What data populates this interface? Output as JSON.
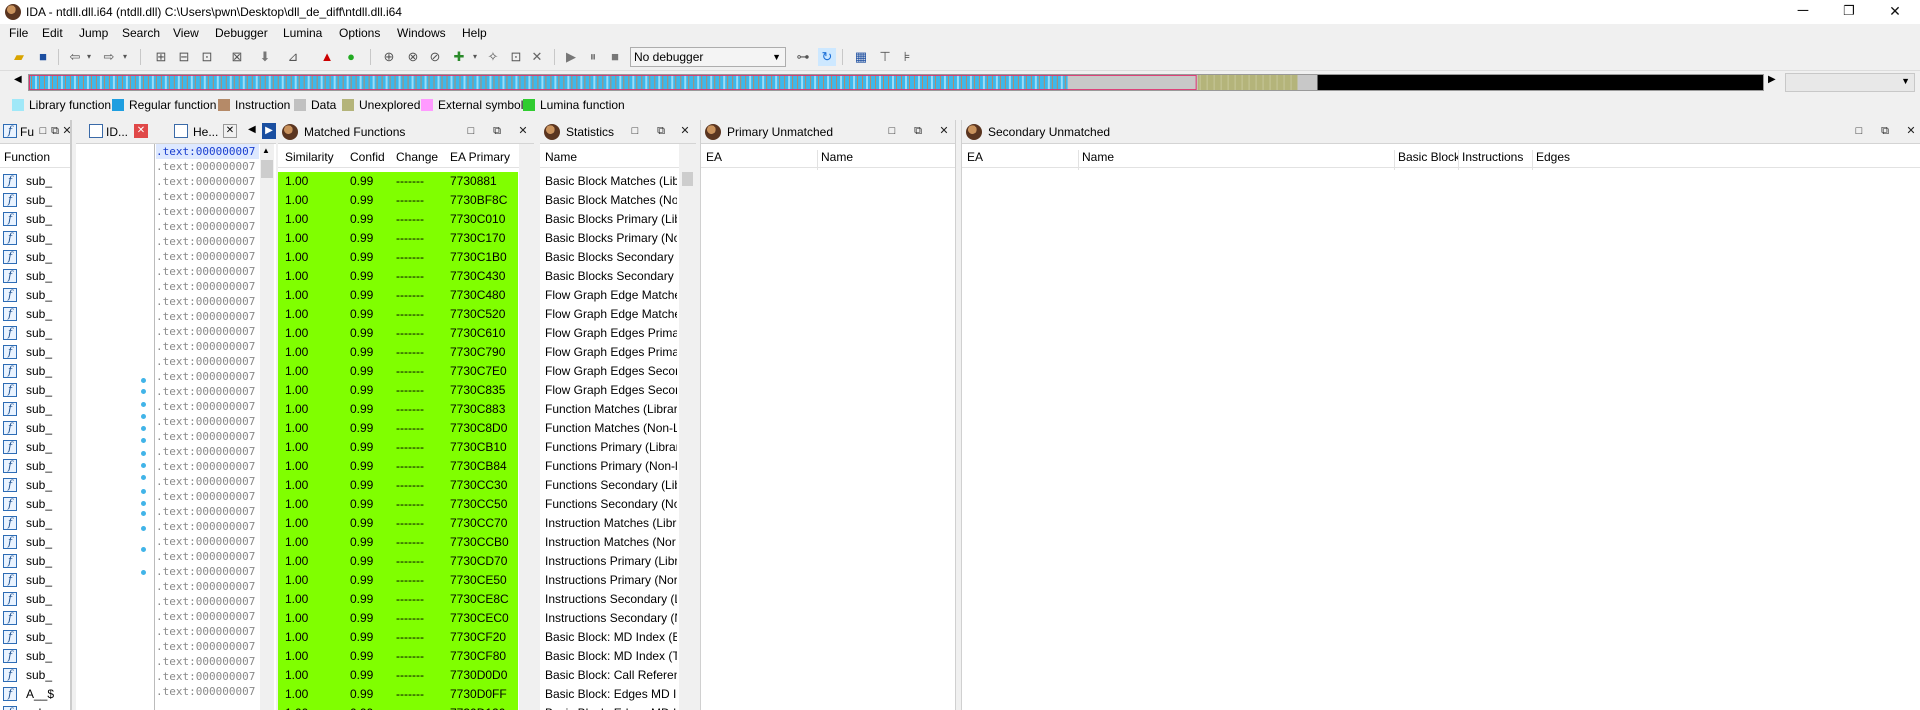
{
  "window": {
    "title": "IDA - ntdll.dll.i64 (ntdll.dll) C:\\Users\\pwn\\Desktop\\dll_de_diff\\ntdll.dll.i64",
    "minimize": "─",
    "maximize": "❐",
    "close": "✕"
  },
  "menu": [
    "File",
    "Edit",
    "Jump",
    "Search",
    "View",
    "Debugger",
    "Lumina",
    "Options",
    "Windows",
    "Help"
  ],
  "toolbar": {
    "debugger_select": "No debugger"
  },
  "legend": [
    {
      "label": "Library function",
      "color": "#a0e8f8"
    },
    {
      "label": "Regular function",
      "color": "#1e9ee0"
    },
    {
      "label": "Instruction",
      "color": "#b58a68"
    },
    {
      "label": "Data",
      "color": "#c0c0c0"
    },
    {
      "label": "Unexplored",
      "color": "#b4b47a"
    },
    {
      "label": "External symbol",
      "color": "#ff9aff"
    },
    {
      "label": "Lumina function",
      "color": "#30cc30"
    }
  ],
  "functions_panel": {
    "tab": "Fu",
    "header": "Function",
    "names": [
      "sub_",
      "sub_",
      "sub_",
      "sub_",
      "sub_",
      "sub_",
      "sub_",
      "sub_",
      "sub_",
      "sub_",
      "sub_",
      "sub_",
      "sub_",
      "sub_",
      "sub_",
      "sub_",
      "sub_",
      "sub_",
      "sub_",
      "sub_",
      "sub_",
      "sub_",
      "sub_",
      "sub_",
      "sub_",
      "sub_",
      "sub_",
      "A__$",
      "sub_"
    ]
  },
  "ida_view": {
    "tab_ida": "ID...",
    "tab_hex": "He...",
    "lines": [
      ".text:000000007",
      ".text:000000007",
      ".text:000000007",
      ".text:000000007",
      ".text:000000007",
      ".text:000000007",
      ".text:000000007",
      ".text:000000007",
      ".text:000000007",
      ".text:000000007",
      ".text:000000007",
      ".text:000000007",
      ".text:000000007",
      ".text:000000007",
      ".text:000000007",
      ".text:000000007",
      ".text:000000007",
      ".text:000000007",
      ".text:000000007",
      ".text:000000007",
      ".text:000000007",
      ".text:000000007",
      ".text:000000007",
      ".text:000000007",
      ".text:000000007",
      ".text:000000007",
      ".text:000000007",
      ".text:000000007",
      ".text:000000007",
      ".text:000000007",
      ".text:000000007",
      ".text:000000007",
      ".text:000000007",
      ".text:000000007",
      ".text:000000007",
      ".text:000000007",
      ".text:000000007"
    ]
  },
  "matched": {
    "title": "Matched Functions",
    "headers": [
      "Similarity",
      "Confid",
      "Change",
      "EA Primary"
    ],
    "rows": [
      [
        "1.00",
        "0.99",
        "-------",
        "7730881"
      ],
      [
        "1.00",
        "0.99",
        "-------",
        "7730BF8C"
      ],
      [
        "1.00",
        "0.99",
        "-------",
        "7730C010"
      ],
      [
        "1.00",
        "0.99",
        "-------",
        "7730C170"
      ],
      [
        "1.00",
        "0.99",
        "-------",
        "7730C1B0"
      ],
      [
        "1.00",
        "0.99",
        "-------",
        "7730C430"
      ],
      [
        "1.00",
        "0.99",
        "-------",
        "7730C480"
      ],
      [
        "1.00",
        "0.99",
        "-------",
        "7730C520"
      ],
      [
        "1.00",
        "0.99",
        "-------",
        "7730C610"
      ],
      [
        "1.00",
        "0.99",
        "-------",
        "7730C790"
      ],
      [
        "1.00",
        "0.99",
        "-------",
        "7730C7E0"
      ],
      [
        "1.00",
        "0.99",
        "-------",
        "7730C835"
      ],
      [
        "1.00",
        "0.99",
        "-------",
        "7730C883"
      ],
      [
        "1.00",
        "0.99",
        "-------",
        "7730C8D0"
      ],
      [
        "1.00",
        "0.99",
        "-------",
        "7730CB10"
      ],
      [
        "1.00",
        "0.99",
        "-------",
        "7730CB84"
      ],
      [
        "1.00",
        "0.99",
        "-------",
        "7730CC30"
      ],
      [
        "1.00",
        "0.99",
        "-------",
        "7730CC50"
      ],
      [
        "1.00",
        "0.99",
        "-------",
        "7730CC70"
      ],
      [
        "1.00",
        "0.99",
        "-------",
        "7730CCB0"
      ],
      [
        "1.00",
        "0.99",
        "-------",
        "7730CD70"
      ],
      [
        "1.00",
        "0.99",
        "-------",
        "7730CE50"
      ],
      [
        "1.00",
        "0.99",
        "-------",
        "7730CE8C"
      ],
      [
        "1.00",
        "0.99",
        "-------",
        "7730CEC0"
      ],
      [
        "1.00",
        "0.99",
        "-------",
        "7730CF20"
      ],
      [
        "1.00",
        "0.99",
        "-------",
        "7730CF80"
      ],
      [
        "1.00",
        "0.99",
        "-------",
        "7730D0D0"
      ],
      [
        "1.00",
        "0.99",
        "-------",
        "7730D0FF"
      ],
      [
        "1.00",
        "0.99",
        "-------",
        "7730D120"
      ]
    ]
  },
  "statistics": {
    "title": "Statistics",
    "header": "Name",
    "rows": [
      "Basic Block Matches (Libr",
      "Basic Block Matches (Non",
      "Basic Blocks Primary (Libr",
      "Basic Blocks Primary (Nor",
      "Basic Blocks Secondary (L",
      "Basic Blocks Secondary (N",
      "Flow Graph Edge Matche",
      "Flow Graph Edge Matche",
      "Flow Graph Edges Primar",
      "Flow Graph Edges Primar",
      "Flow Graph Edges Second",
      "Flow Graph Edges Second",
      "Function Matches (Librar",
      "Function Matches (Non-L",
      "Functions Primary (Librar",
      "Functions Primary (Non-l",
      "Functions Secondary (Lib",
      "Functions Secondary (No",
      "Instruction Matches (Libr",
      "Instruction Matches (Nor",
      "Instructions Primary (Libr",
      "Instructions Primary (Nor",
      "Instructions Secondary (L",
      "Instructions Secondary (N",
      "Basic Block: MD Index (Bo",
      "Basic Block: MD Index (To",
      "Basic Block: Call Referenc",
      "Basic Block: Edges MD In",
      "Basic Block: Edges MD In"
    ]
  },
  "primary_unmatched": {
    "title": "Primary Unmatched",
    "headers": [
      "EA",
      "Name"
    ]
  },
  "secondary_unmatched": {
    "title": "Secondary Unmatched",
    "headers": [
      "EA",
      "Name",
      "Basic Block",
      "Instructions",
      "Edges"
    ]
  },
  "icons": [
    "app-icon",
    "open-icon",
    "save-icon",
    "back-icon",
    "forward-icon",
    "play-icon",
    "pause-icon",
    "stop-icon",
    "function-icon"
  ]
}
